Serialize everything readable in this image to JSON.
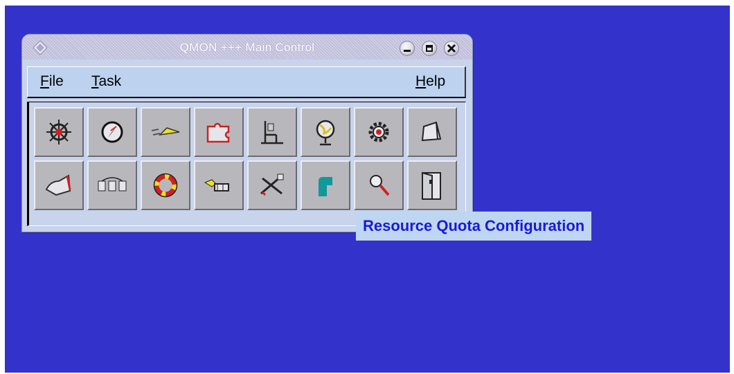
{
  "window": {
    "title": "QMON +++ Main Control",
    "controls": {
      "minimize": "minimize-icon",
      "maximize": "maximize-icon",
      "close": "close-icon"
    }
  },
  "menubar": {
    "file": {
      "mnemonic": "F",
      "rest": "ile"
    },
    "task": {
      "mnemonic": "T",
      "rest": "ask"
    },
    "help": {
      "mnemonic": "H",
      "rest": "elp"
    }
  },
  "toolbar": {
    "row1": [
      "ship-wheel-icon",
      "compass-icon",
      "paper-plane-icon",
      "puzzle-icon",
      "chair-icon",
      "globe-icon",
      "gear-icon",
      "ticket-icon"
    ],
    "row2": [
      "hand-icon",
      "network-icon",
      "lifebuoy-icon",
      "people-icon",
      "tools-icon",
      "quota-corner-icon",
      "magnifier-icon",
      "door-icon"
    ]
  },
  "tooltip": {
    "text": "Resource Quota Configuration"
  },
  "colors": {
    "desktop": "#3333cc",
    "window": "#c8d3ec",
    "menubar": "#bcd2ee",
    "tooltip_text": "#1a1ad9",
    "teal": "#119999"
  }
}
